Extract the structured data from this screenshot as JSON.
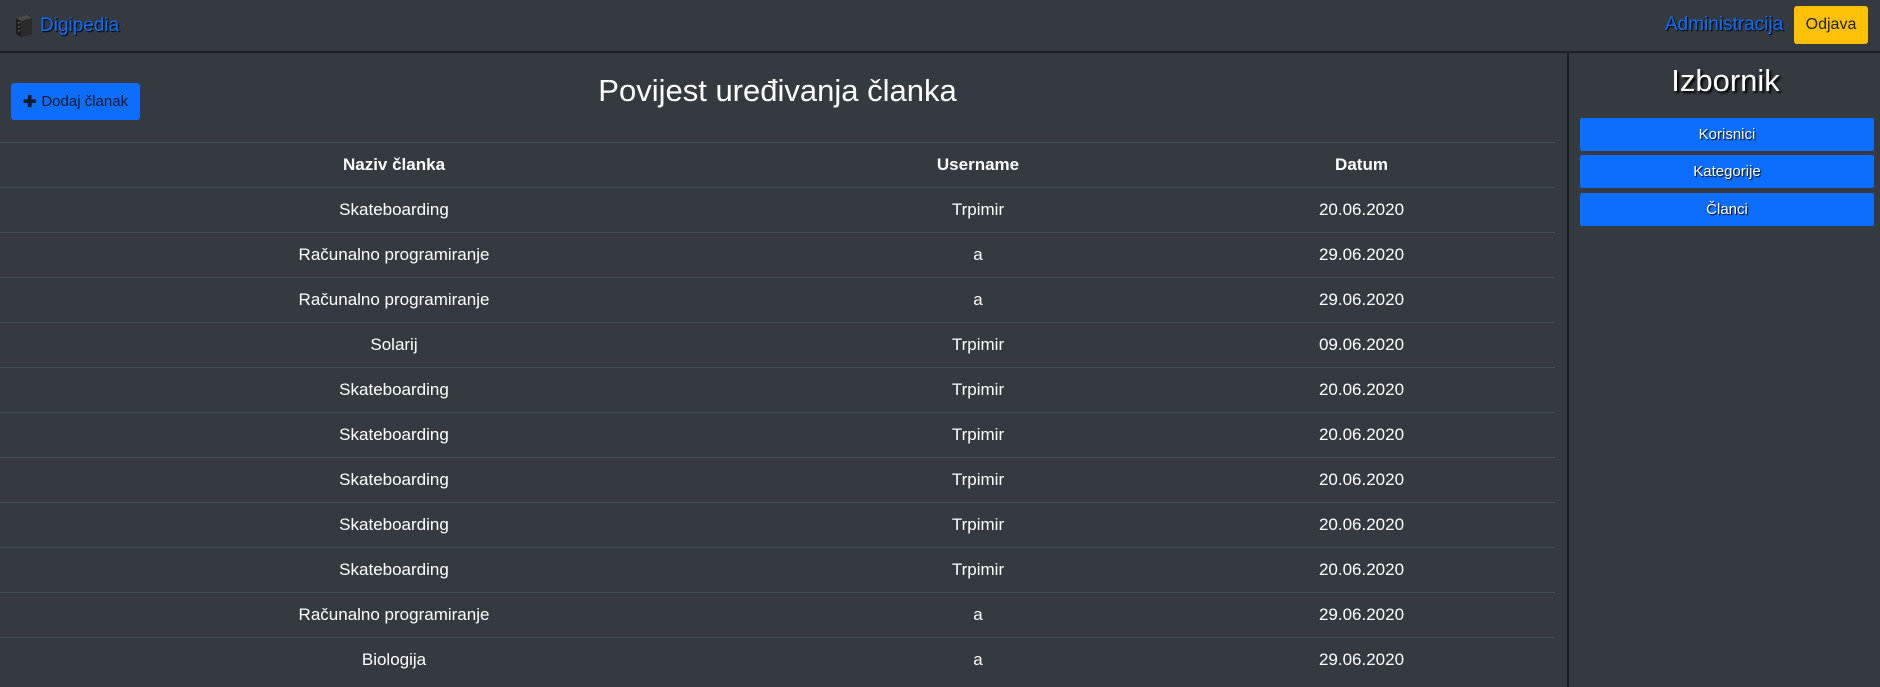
{
  "navbar": {
    "brand": "Digipedia",
    "brand_icon": "book-icon",
    "admin_link": "Administracija",
    "logout_label": "Odjava"
  },
  "main": {
    "add_button_label": "Dodaj članak",
    "add_button_icon": "plus-icon",
    "title": "Povijest uređivanja članka",
    "table": {
      "headers": [
        "Naziv članka",
        "Username",
        "Datum"
      ],
      "rows": [
        [
          "Skateboarding",
          "Trpimir",
          "20.06.2020"
        ],
        [
          "Računalno programiranje",
          "a",
          "29.06.2020"
        ],
        [
          "Računalno programiranje",
          "a",
          "29.06.2020"
        ],
        [
          "Solarij",
          "Trpimir",
          "09.06.2020"
        ],
        [
          "Skateboarding",
          "Trpimir",
          "20.06.2020"
        ],
        [
          "Skateboarding",
          "Trpimir",
          "20.06.2020"
        ],
        [
          "Skateboarding",
          "Trpimir",
          "20.06.2020"
        ],
        [
          "Skateboarding",
          "Trpimir",
          "20.06.2020"
        ],
        [
          "Skateboarding",
          "Trpimir",
          "20.06.2020"
        ],
        [
          "Računalno programiranje",
          "a",
          "29.06.2020"
        ],
        [
          "Biologija",
          "a",
          "29.06.2020"
        ]
      ]
    }
  },
  "sidebar": {
    "title": "Izbornik",
    "items": [
      "Korisnici",
      "Kategorije",
      "Članci"
    ]
  },
  "colors": {
    "background": "#343a40",
    "primary": "#0d6efd",
    "warning": "#ffc107"
  }
}
